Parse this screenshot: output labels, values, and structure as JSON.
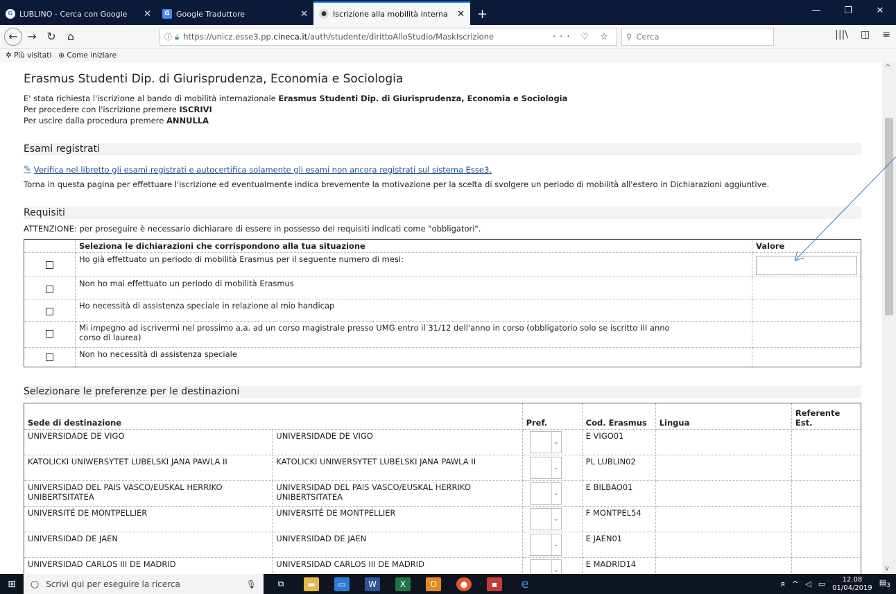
{
  "browser": {
    "tabs": [
      {
        "label": "LUBLINO - Cerca con Google",
        "icon": "G",
        "color": "#4285f4"
      },
      {
        "label": "Google Traduttore",
        "icon": "G",
        "color": "#4a8af4"
      },
      {
        "label": "Iscrizione alla mobilità interna",
        "icon": "●",
        "color": "#333"
      }
    ],
    "url_prefix": "https://unicz.esse3.pp.",
    "url_domain": "cineca.it",
    "url_suffix": "/auth/studente/dirittoAlloStudio/MaskIscrizione",
    "search_placeholder": "Cerca",
    "bookmarks": [
      "Più visitati",
      "Come iniziare"
    ]
  },
  "page": {
    "title": "Erasmus Studenti Dip. di Giurisprudenza, Economia e Sociologia",
    "intro_1_pre": "E' stata richiesta l'iscrizione al bando di mobilità  internazionale ",
    "intro_1_bold": "Erasmus Studenti Dip. di Giurisprudenza, Economia e Sociologia",
    "intro_2_pre": "Per procedere con l'iscrizione premere ",
    "intro_2_bold": "ISCRIVI",
    "intro_3_pre": "Per uscire dalla procedura premere ",
    "intro_3_bold": "ANNULLA",
    "section_exams": "Esami registrati",
    "exams_link": "Verifica nel libretto gli esami registrati e autocertifica solamente gli esami non ancora registrati sul sistema Esse3.",
    "exams_note": "Torna in questa pagina per effettuare l'iscrizione ed eventualmente indica brevemente la motivazione per la scelta di svolgere un periodo di mobilità all'estero in Dichiarazioni aggiuntive.",
    "section_req": "Requisiti",
    "req_warning": "ATTENZIONE: per proseguire è necessario dichiarare di essere in possesso dei requisiti indicati come \"obbligatori\".",
    "req_header_desc": "Seleziona le dichiarazioni che corrispondono alla tua situazione",
    "req_header_value": "Valore",
    "requirements": [
      "Ho già effettuato un periodo di mobilità Erasmus per il seguente numero di mesi:",
      "Non ho mai effettuato un periodo di mobilità Erasmus",
      "Ho necessità di assistenza speciale in relazione al mio handicap",
      "Mi impegno ad iscrivermi nel prossimo a.a. ad un corso magistrale presso UMG entro il 31/12 dell'anno in corso (obbligatorio solo se iscritto III anno corso di laurea)",
      "Non ho necessità di assistenza speciale"
    ],
    "section_dest": "Selezionare le preferenze per le destinazioni",
    "dest_headers": {
      "sede": "Sede di destinazione",
      "pref": "Pref.",
      "cod": "Cod. Erasmus",
      "lingua": "Lingua",
      "ref": "Referente Est."
    },
    "destinations": [
      {
        "sede": "UNIVERSIDADE DE VIGO",
        "sede2": "UNIVERSIDADE DE VIGO",
        "cod": "E VIGO01"
      },
      {
        "sede": "KATOLICKI UNIWERSYTET LUBELSKI JANA PAWLA II",
        "sede2": "KATOLICKI UNIWERSYTET LUBELSKI JANA PAWLA II",
        "cod": "PL LUBLIN02"
      },
      {
        "sede": "UNIVERSIDAD DEL PAIS VASCO/EUSKAL HERRIKO UNIBERTSITATEA",
        "sede2": "UNIVERSIDAD DEL PAIS VASCO/EUSKAL HERRIKO UNIBERTSITATEA",
        "cod": "E BILBAO01"
      },
      {
        "sede": "UNIVERSITÉ DE MONTPELLIER",
        "sede2": "UNIVERSITÉ DE MONTPELLIER",
        "cod": "F MONTPEL54"
      },
      {
        "sede": "UNIVERSIDAD DE JAEN",
        "sede2": "UNIVERSIDAD DE JAEN",
        "cod": "E JAEN01"
      },
      {
        "sede": "UNIVERSIDAD CARLOS III DE MADRID",
        "sede2": "UNIVERSIDAD CARLOS III DE MADRID",
        "cod": "E MADRID14"
      }
    ]
  },
  "taskbar": {
    "search_placeholder": "Scrivi qui per eseguire la ricerca",
    "time": "12.08",
    "date": "01/04/2019",
    "notif_count": "3"
  },
  "colors": {
    "link": "#1a4f8b",
    "annotation_arrow": "#3a7bd5"
  }
}
